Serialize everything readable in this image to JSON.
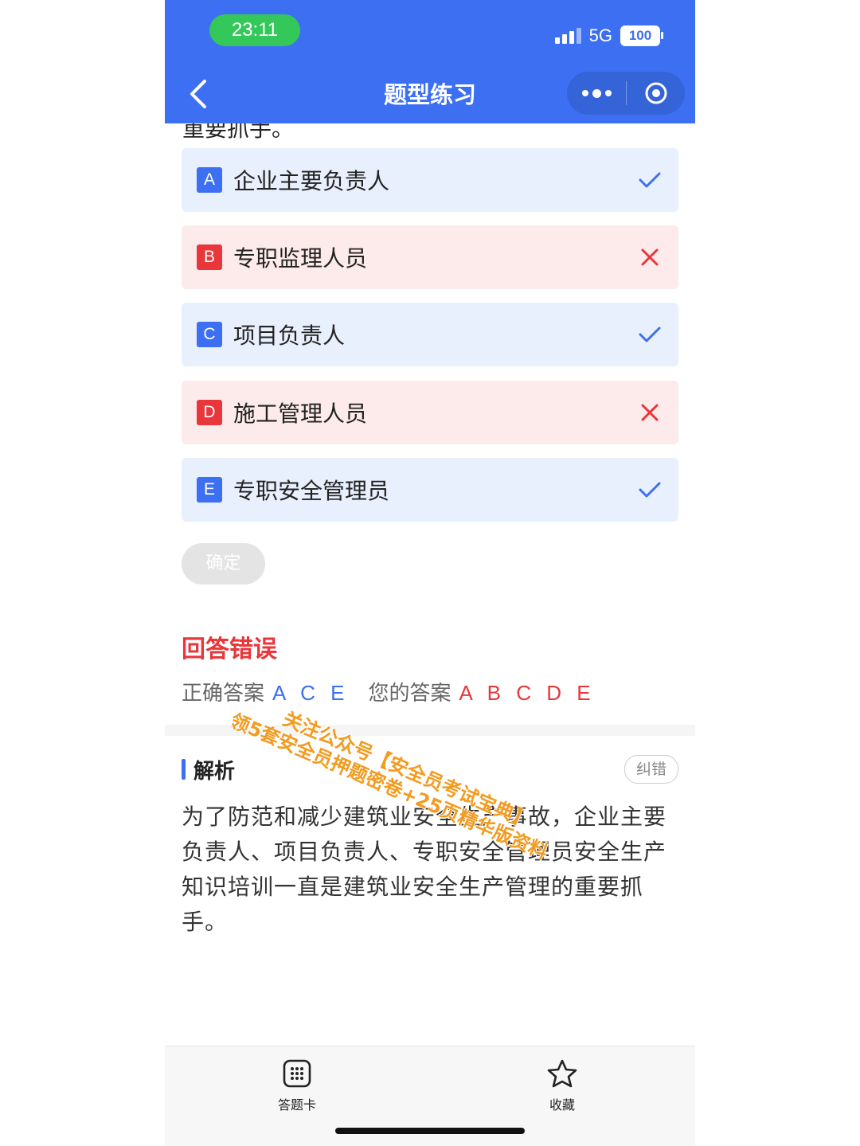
{
  "status_bar": {
    "time": "23:11",
    "network": "5G",
    "battery": "100"
  },
  "nav": {
    "title": "题型练习",
    "back_icon": "chevron-left-icon",
    "more_icon": "more-dots-icon",
    "close_icon": "target-close-icon"
  },
  "question_tail": "重要抓手。",
  "options": [
    {
      "letter": "A",
      "text": "企业主要负责人",
      "status": "correct"
    },
    {
      "letter": "B",
      "text": "专职监理人员",
      "status": "wrong"
    },
    {
      "letter": "C",
      "text": "项目负责人",
      "status": "correct"
    },
    {
      "letter": "D",
      "text": "施工管理人员",
      "status": "wrong"
    },
    {
      "letter": "E",
      "text": "专职安全管理员",
      "status": "correct"
    }
  ],
  "confirm_label": "确定",
  "result": {
    "title": "回答错误",
    "correct_label": "正确答案",
    "correct_value": "A C E",
    "mine_label": "您的答案",
    "mine_value": "A B C D E"
  },
  "analysis": {
    "title": "解析",
    "report_label": "纠错",
    "body": "为了防范和减少建筑业安全生产事故，企业主要负责人、项目负责人、专职安全管理员安全生产知识培训一直是建筑业安全生产管理的重要抓手。"
  },
  "watermark": {
    "line1": "关注公众号【安全员考试宝典】",
    "line2": "领5套安全员押题密卷+25页精华版资料"
  },
  "bottom_tabs": [
    {
      "label": "答题卡",
      "icon": "grid-card-icon"
    },
    {
      "label": "收藏",
      "icon": "star-icon"
    }
  ],
  "colors": {
    "primary": "#3d6ff3",
    "error": "#e8363a",
    "correct_bg": "#e8effd",
    "wrong_bg": "#fdeaea",
    "watermark": "#f29b1f"
  }
}
